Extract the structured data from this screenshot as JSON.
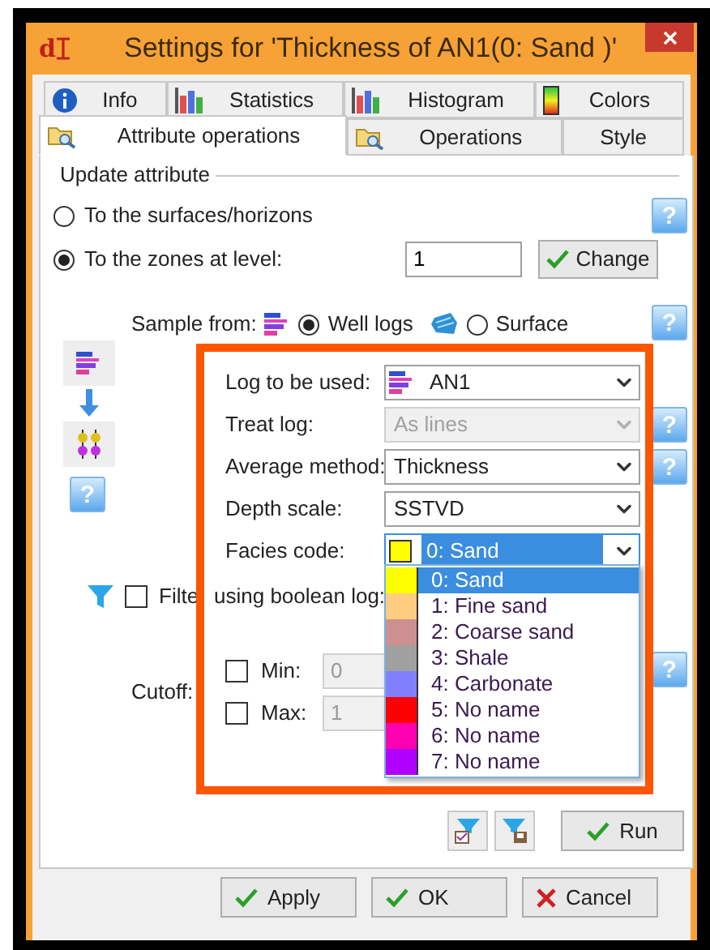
{
  "window": {
    "logo": "d",
    "title": "Settings for 'Thickness of AN1(0: Sand )'"
  },
  "tabs_row1": [
    {
      "label": "Info",
      "selected": false
    },
    {
      "label": "Statistics",
      "selected": false
    },
    {
      "label": "Histogram",
      "selected": false
    },
    {
      "label": "Colors",
      "selected": false
    }
  ],
  "tabs_row2": [
    {
      "label": "Attribute operations",
      "selected": true
    },
    {
      "label": "Operations",
      "selected": false
    },
    {
      "label": "Style",
      "selected": false
    }
  ],
  "update_attribute": {
    "title": "Update attribute",
    "help": "?",
    "options": [
      {
        "label": "To the surfaces/horizons",
        "selected": false
      },
      {
        "label": "To the zones at level:",
        "selected": true
      }
    ],
    "zone_value": "1",
    "change_button": "Change"
  },
  "sample_from": {
    "label": "Sample from:",
    "help": "?",
    "options": [
      {
        "label": "Well logs",
        "selected": true
      },
      {
        "label": "Surface",
        "selected": false
      }
    ]
  },
  "side_help": "?",
  "log_fields": [
    {
      "label": "Log to be used:",
      "kind": "log",
      "value": "AN1",
      "disabled": false
    },
    {
      "label": "Treat log:",
      "kind": "plain",
      "value": "As lines",
      "disabled": true,
      "help": "?"
    },
    {
      "label": "Average method:",
      "kind": "plain",
      "value": "Thickness",
      "disabled": false,
      "help": "?"
    },
    {
      "label": "Depth scale:",
      "kind": "plain",
      "value": "SSTVD",
      "disabled": false
    },
    {
      "label": "Facies code:",
      "kind": "facies",
      "value": "0: Sand",
      "color": "#ffff00",
      "disabled": false,
      "expanded": true
    }
  ],
  "facies_options": [
    {
      "label": "0: Sand",
      "color": "#ffff00",
      "selected": true
    },
    {
      "label": "1: Fine sand",
      "color": "#ffcc80",
      "selected": false
    },
    {
      "label": "2: Coarse sand",
      "color": "#cc9090",
      "selected": false
    },
    {
      "label": "3: Shale",
      "color": "#a0a0a0",
      "selected": false
    },
    {
      "label": "4: Carbonate",
      "color": "#8080ff",
      "selected": false
    },
    {
      "label": "5: No name",
      "color": "#ff0000",
      "selected": false
    },
    {
      "label": "6: No name",
      "color": "#ff00b0",
      "selected": false
    },
    {
      "label": "7: No name",
      "color": "#b000ff",
      "selected": false
    }
  ],
  "filter": {
    "label_parts": [
      "Filte",
      "using boolean log:"
    ],
    "checked": false
  },
  "cutoff": {
    "label": "Cutoff:",
    "help": "?",
    "rows": [
      {
        "label": "Min:",
        "checked": false,
        "value": "0",
        "disabled": true
      },
      {
        "label": "Max:",
        "checked": false,
        "value": "1",
        "disabled": true
      }
    ]
  },
  "run_button": "Run",
  "dialog_buttons": [
    {
      "label": "Apply",
      "kind": "ok"
    },
    {
      "label": "OK",
      "kind": "ok"
    },
    {
      "label": "Cancel",
      "kind": "cancel"
    }
  ]
}
